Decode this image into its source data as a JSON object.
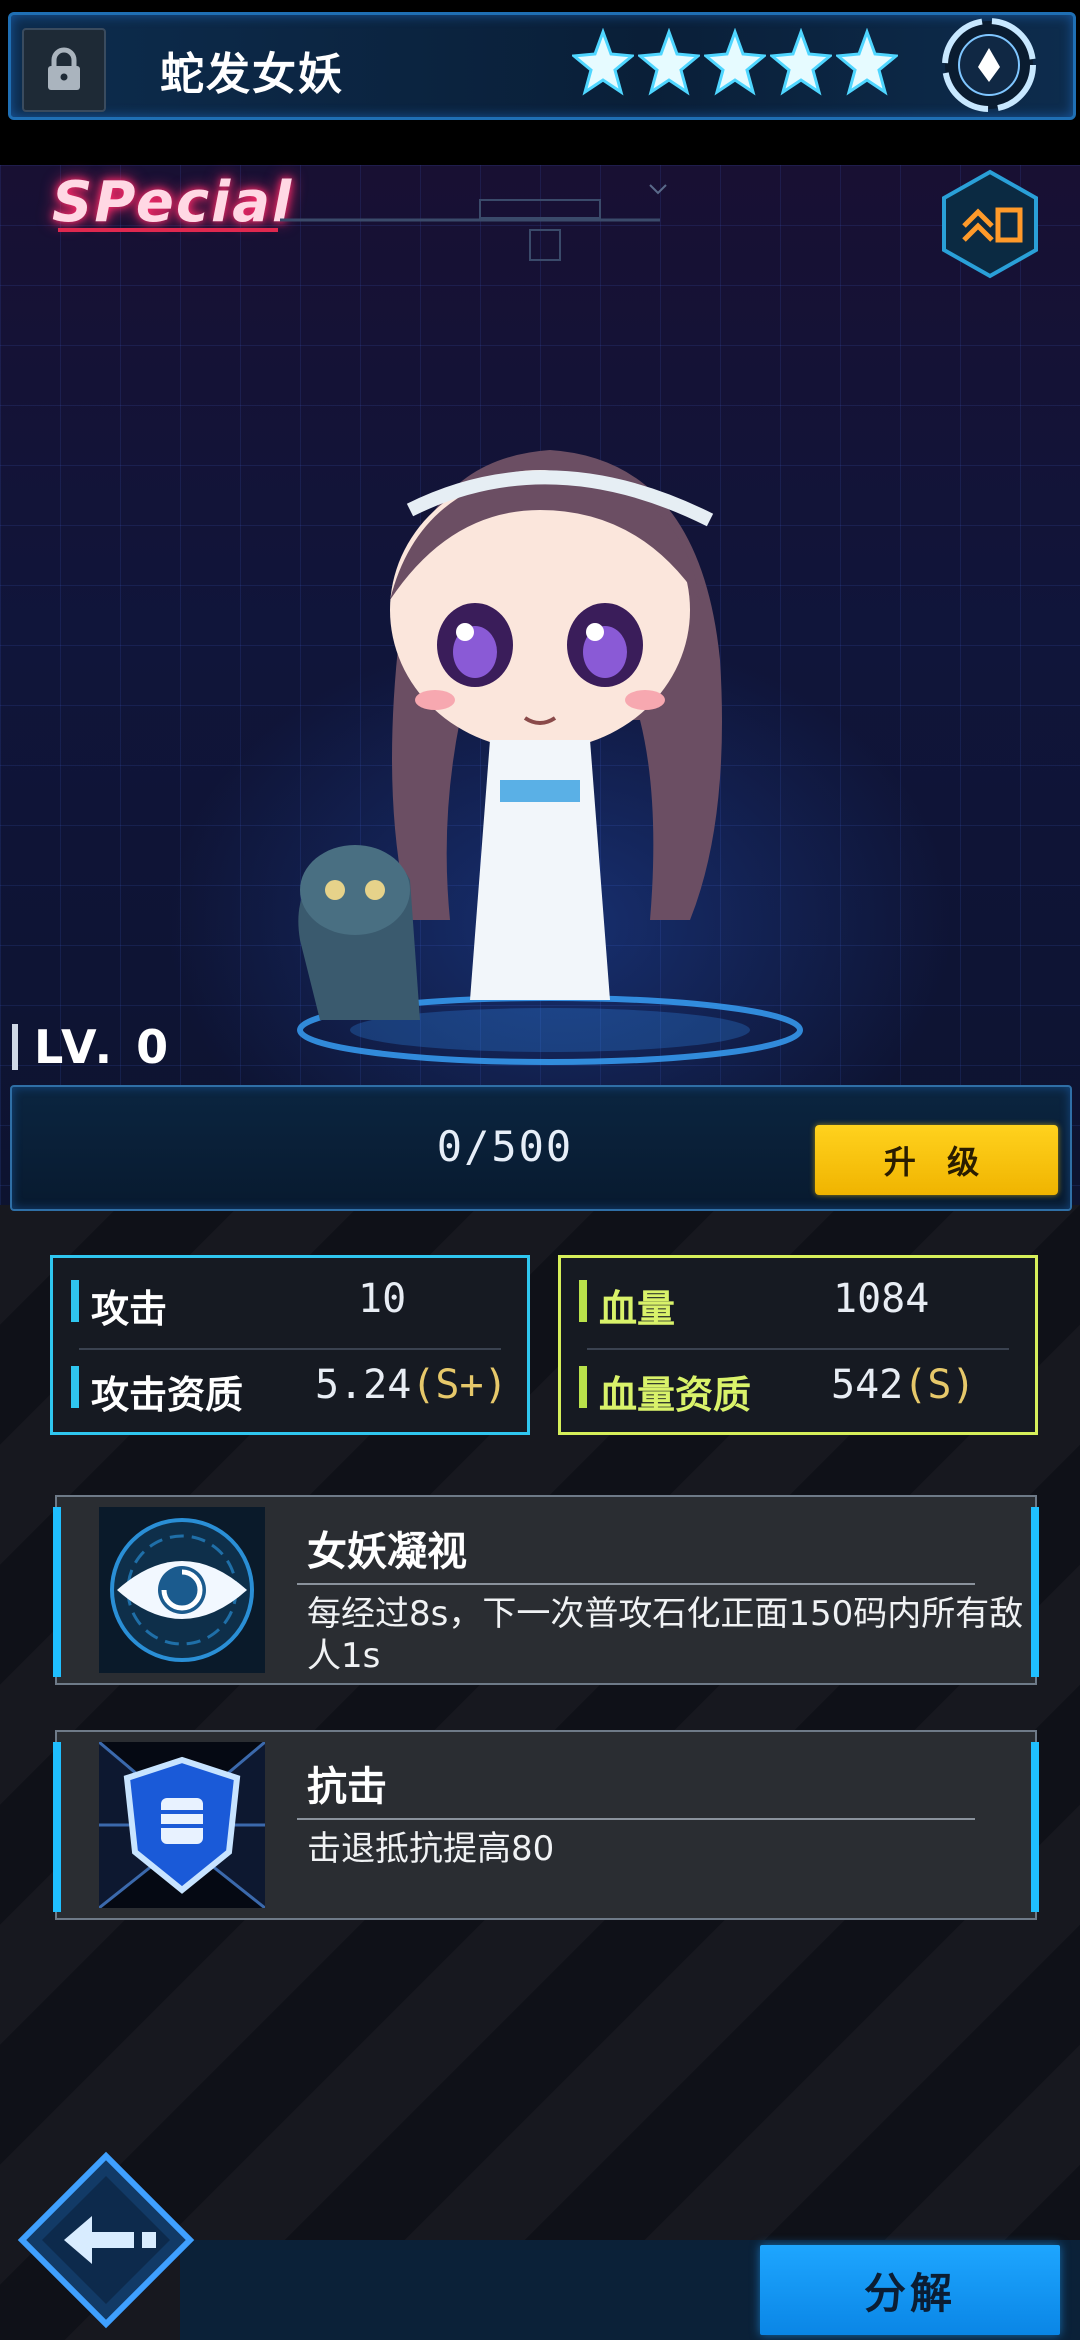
{
  "header": {
    "title": "蛇发女妖",
    "star_count": 5,
    "lock_icon": "lock-icon",
    "badge_icon": "element-badge-icon"
  },
  "rarity_label": "SPecial",
  "level": {
    "label": "LV. 0"
  },
  "experience": {
    "text": "0/500",
    "progress": 0
  },
  "upgrade_button": "升 级",
  "stats": {
    "attack": {
      "label": "攻击",
      "value": "10"
    },
    "attack_quality": {
      "label": "攻击资质",
      "value": "5.24",
      "grade": "(S+)"
    },
    "hp": {
      "label": "血量",
      "value": "1084"
    },
    "hp_quality": {
      "label": "血量资质",
      "value": "542",
      "grade": "(S)"
    }
  },
  "skills": [
    {
      "name": "女妖凝视",
      "description": "每经过8s，下一次普攻石化正面150码内所有敌人1s",
      "icon": "eye-icon"
    },
    {
      "name": "抗击",
      "description": "击退抵抗提高80",
      "icon": "shield-fist-icon"
    }
  ],
  "decompose_button": "分解",
  "colors": {
    "attack_accent": "#2fc6ef",
    "hp_accent": "#d6ef5a",
    "upgrade": "#ffd21e",
    "decompose": "#1ea6ff",
    "special": "#ff2a6a"
  }
}
